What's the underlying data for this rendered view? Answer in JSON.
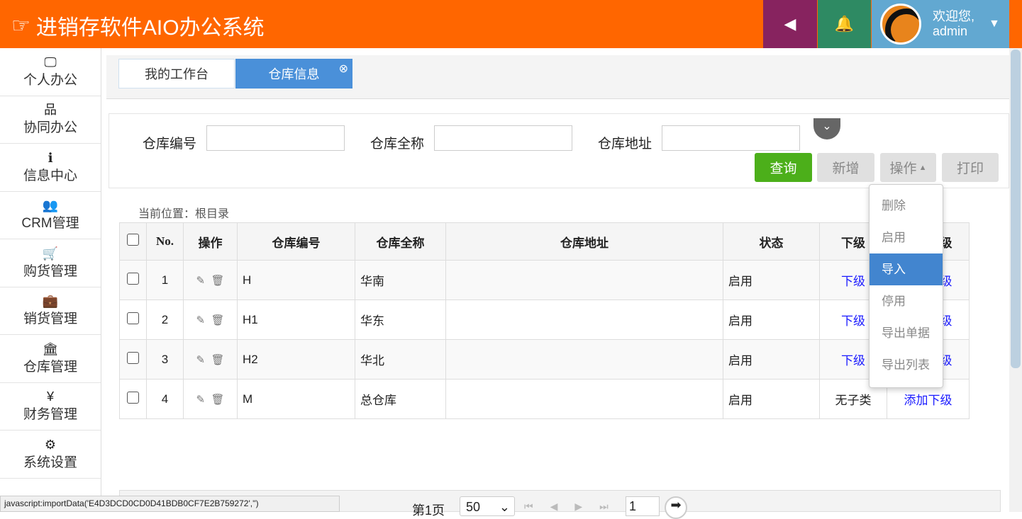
{
  "header": {
    "title": "进销存软件AIO办公系统",
    "welcome": "欢迎您,",
    "username": "admin",
    "colors": {
      "bar": "#ff6600",
      "sound": "#87235f",
      "bell": "#2e8a63",
      "user": "#62a8d1"
    }
  },
  "sidebar": {
    "items": [
      {
        "label": "个人办公",
        "icon": "monitor-icon",
        "glyph": "🖵"
      },
      {
        "label": "协同办公",
        "icon": "sitemap-icon",
        "glyph": "品"
      },
      {
        "label": "信息中心",
        "icon": "info-icon",
        "glyph": "ℹ"
      },
      {
        "label": "CRM管理",
        "icon": "users-icon",
        "glyph": "👥"
      },
      {
        "label": "购货管理",
        "icon": "cart-icon",
        "glyph": "🛒"
      },
      {
        "label": "销货管理",
        "icon": "briefcase-icon",
        "glyph": "💼"
      },
      {
        "label": "仓库管理",
        "icon": "bank-icon",
        "glyph": "🏛"
      },
      {
        "label": "财务管理",
        "icon": "yen-icon",
        "glyph": "¥"
      },
      {
        "label": "系统设置",
        "icon": "gear-icon",
        "glyph": "⚙"
      }
    ]
  },
  "tabs": [
    {
      "label": "我的工作台"
    },
    {
      "label": "仓库信息",
      "active": true
    }
  ],
  "search": {
    "fields": [
      {
        "label": "仓库编号",
        "value": ""
      },
      {
        "label": "仓库全称",
        "value": ""
      },
      {
        "label": "仓库地址",
        "value": ""
      }
    ],
    "buttons": {
      "query": "查询",
      "add": "新增",
      "ops": "操作",
      "print": "打印"
    }
  },
  "location": "当前位置：根目录",
  "table": {
    "headers": [
      "No.",
      "操作",
      "仓库编号",
      "仓库全称",
      "仓库地址",
      "状态",
      "下级",
      "添加下级"
    ],
    "rows": [
      {
        "no": "1",
        "code": "H",
        "name": "华南",
        "addr": "",
        "status": "启用",
        "sub": "下级",
        "add": "添加下级"
      },
      {
        "no": "2",
        "code": "H1",
        "name": "华东",
        "addr": "",
        "status": "启用",
        "sub": "下级",
        "add": "添加下级"
      },
      {
        "no": "3",
        "code": "H2",
        "name": "华北",
        "addr": "",
        "status": "启用",
        "sub": "下级",
        "add": "添加下级"
      },
      {
        "no": "4",
        "code": "M",
        "name": "总仓库",
        "addr": "",
        "status": "启用",
        "sub": "无子类",
        "add": "添加下级"
      }
    ]
  },
  "menu": {
    "items": [
      "删除",
      "启用",
      "导入",
      "停用",
      "导出单据",
      "导出列表"
    ],
    "active": "导入"
  },
  "pager": {
    "page_label": "第1页",
    "page_size": "50",
    "page_input": "1"
  },
  "statusbar": "javascript:importData('E4D3DCD0CD0D41BDB0CF7E2B759272','')"
}
